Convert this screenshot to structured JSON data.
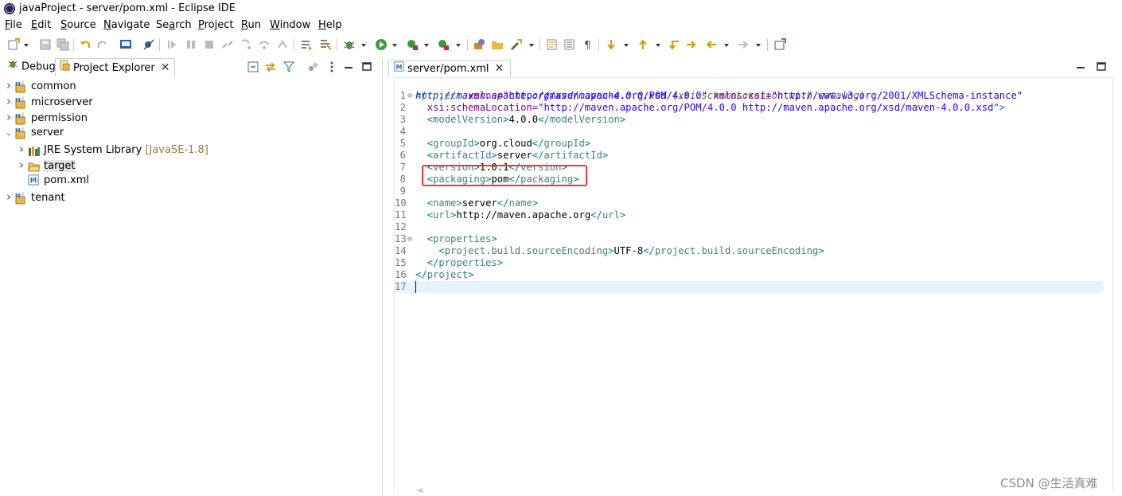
{
  "window": {
    "title": "javaProject - server/pom.xml - Eclipse IDE",
    "app_icon": "eclipse-icon"
  },
  "menubar": {
    "items": [
      {
        "label": "File",
        "mnemonic": "F",
        "rest": "ile"
      },
      {
        "label": "Edit",
        "mnemonic": "E",
        "rest": "dit"
      },
      {
        "label": "Source",
        "mnemonic": "S",
        "rest": "ource"
      },
      {
        "label": "Navigate",
        "mnemonic": "N",
        "rest": "avigate"
      },
      {
        "label": "Search",
        "mnemonic": "",
        "rest": "Search",
        "underline_index": 2
      },
      {
        "label": "Project",
        "mnemonic": "P",
        "rest": "roject"
      },
      {
        "label": "Run",
        "mnemonic": "R",
        "rest": "un"
      },
      {
        "label": "Window",
        "mnemonic": "W",
        "rest": "indow"
      },
      {
        "label": "Help",
        "mnemonic": "H",
        "rest": "elp"
      }
    ]
  },
  "left_panel": {
    "tabs": [
      {
        "label": "Debug",
        "icon": "debug-bug-icon"
      },
      {
        "label": "Project Explorer",
        "icon": "project-explorer-icon"
      }
    ],
    "tree": [
      {
        "label": "common",
        "icon": "maven-project-icon",
        "expanded": false,
        "depth": 0
      },
      {
        "label": "microserver",
        "icon": "maven-project-icon",
        "expanded": false,
        "depth": 0
      },
      {
        "label": "permission",
        "icon": "maven-project-icon",
        "expanded": false,
        "depth": 0
      },
      {
        "label": "server",
        "icon": "maven-project-icon",
        "expanded": true,
        "depth": 0
      },
      {
        "label": "JRE System Library",
        "decoration": "[JavaSE-1.8]",
        "icon": "library-icon",
        "expanded": false,
        "depth": 1
      },
      {
        "label": "target",
        "icon": "folder-open-icon",
        "expanded": false,
        "depth": 1,
        "selected": true
      },
      {
        "label": "pom.xml",
        "icon": "maven-file-icon",
        "depth": 1,
        "leaf": true
      },
      {
        "label": "tenant",
        "icon": "maven-project-icon",
        "expanded": false,
        "depth": 0
      }
    ]
  },
  "editor": {
    "tab_label": "server/pom.xml",
    "hint_line": {
      "url": "http://maven.apache.org/xsd/maven-4.0.0.xsd",
      "note": "(xsi:schemaLocation with catalog)"
    },
    "lines": [
      {
        "n": "1",
        "fold": "⊖",
        "tokens": [
          [
            "b",
            "<"
          ],
          [
            "t",
            "project"
          ],
          [
            "a",
            " xmlns="
          ],
          [
            "v",
            "\"http://maven.apache.org/POM/4.0.0\""
          ],
          [
            "a",
            " xmlns:xsi="
          ],
          [
            "v",
            "\"http://www.w3.org/2001/XMLSchema-instance\""
          ]
        ]
      },
      {
        "n": "2",
        "tokens": [
          [
            "x",
            "  "
          ],
          [
            "a",
            "xsi:schemaLocation="
          ],
          [
            "v",
            "\"http://maven.apache.org/POM/4.0.0 http://maven.apache.org/xsd/maven-4.0.0.xsd\""
          ],
          [
            "b",
            ">"
          ]
        ]
      },
      {
        "n": "3",
        "tokens": [
          [
            "x",
            "  "
          ],
          [
            "b",
            "<"
          ],
          [
            "t",
            "modelVersion"
          ],
          [
            "b",
            ">"
          ],
          [
            "x",
            "4.0.0"
          ],
          [
            "b",
            "</"
          ],
          [
            "t",
            "modelVersion"
          ],
          [
            "b",
            ">"
          ]
        ]
      },
      {
        "n": "4",
        "tokens": []
      },
      {
        "n": "5",
        "tokens": [
          [
            "x",
            "  "
          ],
          [
            "b",
            "<"
          ],
          [
            "t",
            "groupId"
          ],
          [
            "b",
            ">"
          ],
          [
            "x",
            "org.cloud"
          ],
          [
            "b",
            "</"
          ],
          [
            "t",
            "groupId"
          ],
          [
            "b",
            ">"
          ]
        ]
      },
      {
        "n": "6",
        "tokens": [
          [
            "x",
            "  "
          ],
          [
            "b",
            "<"
          ],
          [
            "t",
            "artifactId"
          ],
          [
            "b",
            ">"
          ],
          [
            "x",
            "server"
          ],
          [
            "b",
            "</"
          ],
          [
            "t",
            "artifactId"
          ],
          [
            "b",
            ">"
          ]
        ]
      },
      {
        "n": "7",
        "tokens": [
          [
            "x",
            "  "
          ],
          [
            "b",
            "<"
          ],
          [
            "t",
            "version"
          ],
          [
            "b",
            ">"
          ],
          [
            "x",
            "1.0.1"
          ],
          [
            "b",
            "</"
          ],
          [
            "t",
            "version"
          ],
          [
            "b",
            ">"
          ]
        ]
      },
      {
        "n": "8",
        "tokens": [
          [
            "x",
            "  "
          ],
          [
            "b",
            "<"
          ],
          [
            "t",
            "packaging"
          ],
          [
            "b",
            ">"
          ],
          [
            "x",
            "pom"
          ],
          [
            "b",
            "</"
          ],
          [
            "t",
            "packaging"
          ],
          [
            "b",
            ">"
          ]
        ]
      },
      {
        "n": "9",
        "tokens": []
      },
      {
        "n": "10",
        "tokens": [
          [
            "x",
            "  "
          ],
          [
            "b",
            "<"
          ],
          [
            "t",
            "name"
          ],
          [
            "b",
            ">"
          ],
          [
            "x",
            "server"
          ],
          [
            "b",
            "</"
          ],
          [
            "t",
            "name"
          ],
          [
            "b",
            ">"
          ]
        ]
      },
      {
        "n": "11",
        "tokens": [
          [
            "x",
            "  "
          ],
          [
            "b",
            "<"
          ],
          [
            "t",
            "url"
          ],
          [
            "b",
            ">"
          ],
          [
            "x",
            "http://maven.apache.org"
          ],
          [
            "b",
            "</"
          ],
          [
            "t",
            "url"
          ],
          [
            "b",
            ">"
          ]
        ]
      },
      {
        "n": "12",
        "tokens": []
      },
      {
        "n": "13",
        "fold": "⊖",
        "tokens": [
          [
            "x",
            "  "
          ],
          [
            "b",
            "<"
          ],
          [
            "t",
            "properties"
          ],
          [
            "b",
            ">"
          ]
        ]
      },
      {
        "n": "14",
        "tokens": [
          [
            "x",
            "    "
          ],
          [
            "b",
            "<"
          ],
          [
            "t",
            "project.build.sourceEncoding"
          ],
          [
            "b",
            ">"
          ],
          [
            "x",
            "UTF-8"
          ],
          [
            "b",
            "</"
          ],
          [
            "t",
            "project.build.sourceEncoding"
          ],
          [
            "b",
            ">"
          ]
        ]
      },
      {
        "n": "15",
        "tokens": [
          [
            "x",
            "  "
          ],
          [
            "b",
            "</"
          ],
          [
            "t",
            "properties"
          ],
          [
            "b",
            ">"
          ]
        ]
      },
      {
        "n": "16",
        "tokens": [
          [
            "b",
            "</"
          ],
          [
            "t",
            "project"
          ],
          [
            "b",
            ">"
          ]
        ]
      },
      {
        "n": "17",
        "tokens": [],
        "current": true
      }
    ]
  },
  "annotation": {
    "highlight_color": "#e83a2e",
    "highlighted_lines": [
      "7",
      "8"
    ]
  },
  "watermark": "CSDN @生活真难",
  "colors": {
    "tag": "#3f7f7f",
    "bracket": "#008080",
    "attr": "#7f007f",
    "value": "#2a00ff",
    "current_line": "#e8f2fe",
    "selection": "#e5e5e5"
  }
}
